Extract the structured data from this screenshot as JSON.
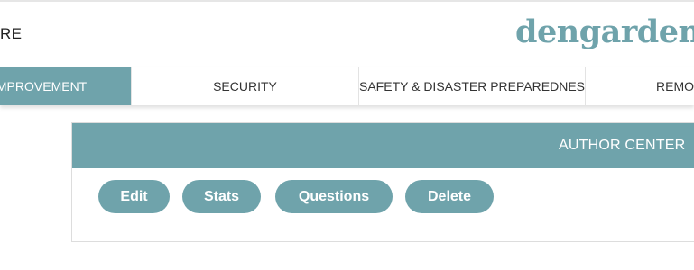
{
  "header": {
    "left_text": "RE",
    "logo_text": "dengarden"
  },
  "nav": {
    "items": [
      {
        "label": "IMPROVEMENT",
        "active": true
      },
      {
        "label": "SECURITY",
        "active": false
      },
      {
        "label": "SAFETY & DISASTER PREPAREDNESS",
        "active": false
      },
      {
        "label": "REMODELING",
        "active": false
      }
    ]
  },
  "author_center": {
    "title": "AUTHOR CENTER",
    "buttons": {
      "edit": "Edit",
      "stats": "Stats",
      "questions": "Questions",
      "delete": "Delete"
    }
  },
  "colors": {
    "accent": "#6fa3ab",
    "text": "#333333",
    "background": "#ffffff"
  }
}
